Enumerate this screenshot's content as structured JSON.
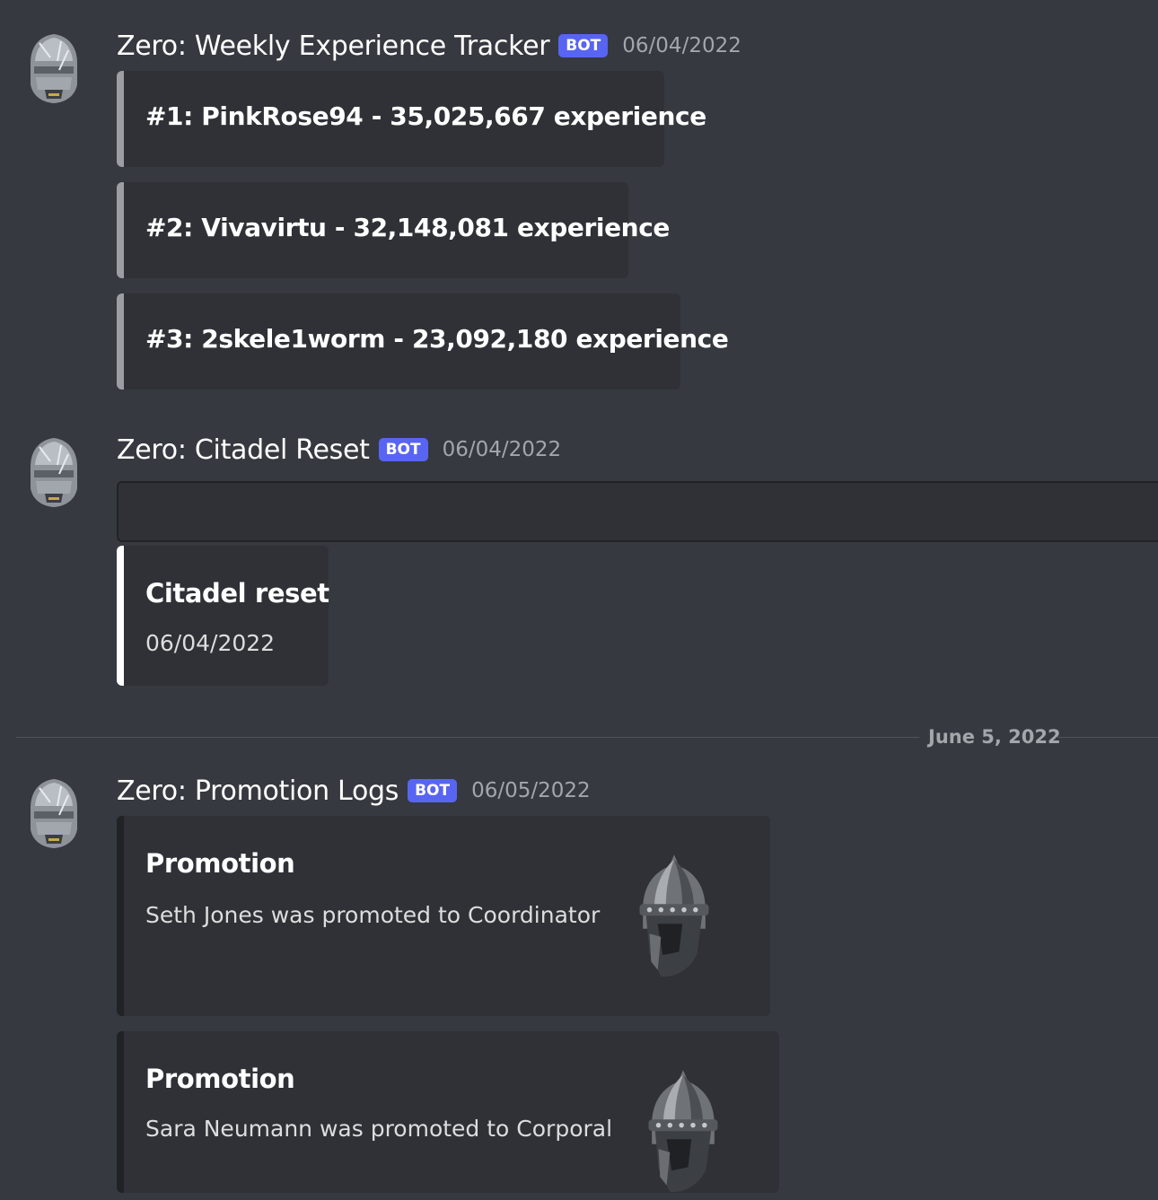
{
  "messages": [
    {
      "author": "Zero: Weekly Experience Tracker",
      "badge": "BOT",
      "timestamp": "06/04/2022",
      "embeds": [
        {
          "line": "#1: PinkRose94 - 35,025,667 experience"
        },
        {
          "line": "#2: Vivavirtu - 32,148,081 experience"
        },
        {
          "line": "#3: 2skele1worm - 23,092,180 experience"
        }
      ]
    },
    {
      "author": "Zero: Citadel Reset",
      "badge": "BOT",
      "timestamp": "06/04/2022",
      "embed": {
        "title": "Citadel reset",
        "description": "06/04/2022",
        "accent_color": "#ffffff"
      }
    },
    {
      "author": "Zero: Promotion Logs",
      "badge": "BOT",
      "timestamp": "06/05/2022",
      "embeds": [
        {
          "title": "Promotion",
          "description": "Seth Jones was promoted to Coordinator",
          "thumbnail": "helmet-icon"
        },
        {
          "title": "Promotion",
          "description": "Sara Neumann was promoted to Corporal",
          "thumbnail": "helmet-icon"
        }
      ]
    }
  ],
  "date_divider": "June 5, 2022",
  "colors": {
    "background": "#36393f",
    "embed_background": "#2f3136",
    "bot_badge": "#5865f2",
    "embed_border_grey": "#9b9ea3",
    "embed_border_dark": "#202225"
  }
}
